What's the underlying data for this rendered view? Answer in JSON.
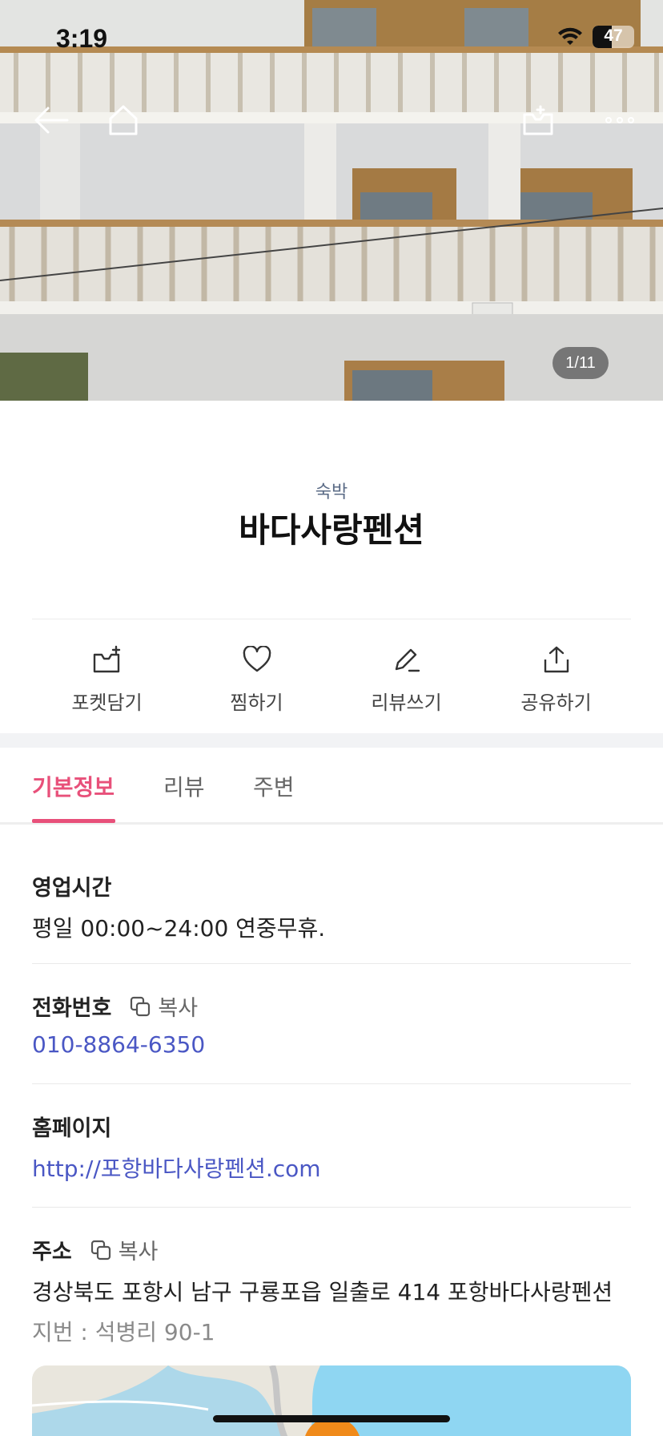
{
  "status_bar": {
    "time": "3:19",
    "battery_level": "47",
    "battery_fraction": 0.47
  },
  "gallery": {
    "page_indicator": "1/11"
  },
  "header": {
    "category": "숙박",
    "name": "바다사랑펜션"
  },
  "actions": [
    {
      "label": "포켓담기",
      "icon": "pocket-add-icon"
    },
    {
      "label": "찜하기",
      "icon": "heart-icon"
    },
    {
      "label": "리뷰쓰기",
      "icon": "pencil-icon"
    },
    {
      "label": "공유하기",
      "icon": "share-icon"
    }
  ],
  "tabs": [
    {
      "label": "기본정보",
      "active": true
    },
    {
      "label": "리뷰",
      "active": false
    },
    {
      "label": "주변",
      "active": false
    }
  ],
  "info": {
    "hours": {
      "title": "영업시간",
      "value": "평일 00:00~24:00 연중무휴."
    },
    "phone": {
      "title": "전화번호",
      "copy_label": "복사",
      "value": "010-8864-6350"
    },
    "homepage": {
      "title": "홈페이지",
      "value": "http://포항바다사랑펜션.com"
    },
    "address": {
      "title": "주소",
      "copy_label": "복사",
      "value": "경상북도 포항시 남구 구룡포읍 일출로 414 포항바다사랑펜션",
      "lot_number": "지번 : 석병리 90-1"
    }
  },
  "colors": {
    "accent": "#e8507a",
    "link": "#4a57c4",
    "category": "#5b6b86"
  }
}
